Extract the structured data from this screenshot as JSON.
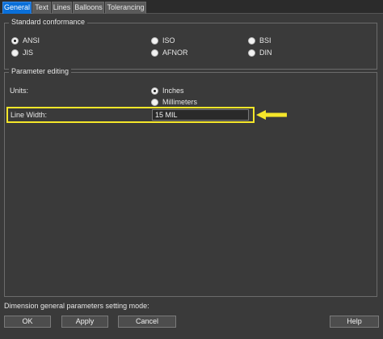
{
  "tabs": [
    "General",
    "Text",
    "Lines",
    "Balloons",
    "Tolerancing"
  ],
  "standard": {
    "title": "Standard conformance",
    "options": [
      "ANSI",
      "ISO",
      "BSI",
      "JIS",
      "AFNOR",
      "DIN"
    ],
    "selected": "ANSI"
  },
  "params": {
    "title": "Parameter editing",
    "units_label": "Units:",
    "units": [
      "Inches",
      "Millimeters"
    ],
    "units_selected": "Inches",
    "line_width_label": "Line Width:",
    "line_width_value": "15 MIL"
  },
  "colors": {
    "active_tab": "#0a6fd8",
    "highlight": "#f5e62a"
  },
  "status_text": "Dimension general parameters setting mode:",
  "buttons": {
    "ok": "OK",
    "apply": "Apply",
    "cancel": "Cancel",
    "help": "Help"
  }
}
